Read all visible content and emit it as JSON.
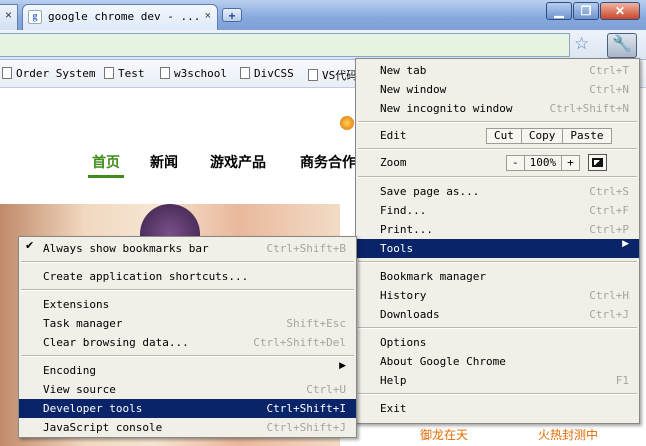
{
  "tab": {
    "title": "google chrome dev - ...",
    "favicon_letter": "g",
    "close_glyph": "×",
    "left_close": "×"
  },
  "newtab_glyph": "+",
  "window": {
    "minimize": "▁",
    "maximize": "❐",
    "close": "✕"
  },
  "toolbar": {
    "star": "☆",
    "wrench": "🔧"
  },
  "bookmarks": [
    "Order System",
    "Test",
    "w3school",
    "DivCSS",
    "VS代码"
  ],
  "page": {
    "nav": [
      "首页",
      "新闻",
      "游戏产品",
      "商务合作"
    ],
    "bottom_left": "御龙在天",
    "bottom_right": "火热封测中"
  },
  "main_menu": {
    "new_tab": {
      "label": "New tab",
      "shortcut": "Ctrl+T"
    },
    "new_window": {
      "label": "New window",
      "shortcut": "Ctrl+N"
    },
    "new_incognito": {
      "label": "New incognito window",
      "shortcut": "Ctrl+Shift+N"
    },
    "edit": {
      "label": "Edit",
      "cut": "Cut",
      "copy": "Copy",
      "paste": "Paste"
    },
    "zoom": {
      "label": "Zoom",
      "minus": "-",
      "level": "100%",
      "plus": "+"
    },
    "save_page": {
      "label": "Save page as...",
      "shortcut": "Ctrl+S"
    },
    "find": {
      "label": "Find...",
      "shortcut": "Ctrl+F"
    },
    "print": {
      "label": "Print...",
      "shortcut": "Ctrl+P"
    },
    "tools": {
      "label": "Tools",
      "arrow": "▶"
    },
    "bookmark_manager": {
      "label": "Bookmark manager"
    },
    "history": {
      "label": "History",
      "shortcut": "Ctrl+H"
    },
    "downloads": {
      "label": "Downloads",
      "shortcut": "Ctrl+J"
    },
    "options": {
      "label": "Options"
    },
    "about": {
      "label": "About Google Chrome"
    },
    "help": {
      "label": "Help",
      "shortcut": "F1"
    },
    "exit": {
      "label": "Exit"
    }
  },
  "tools_menu": {
    "show_bookmarks_bar": {
      "label": "Always show bookmarks bar",
      "shortcut": "Ctrl+Shift+B",
      "check": "✔"
    },
    "create_shortcuts": {
      "label": "Create application shortcuts..."
    },
    "extensions": {
      "label": "Extensions"
    },
    "task_manager": {
      "label": "Task manager",
      "shortcut": "Shift+Esc"
    },
    "clear_data": {
      "label": "Clear browsing data...",
      "shortcut": "Ctrl+Shift+Del"
    },
    "encoding": {
      "label": "Encoding",
      "arrow": "▶"
    },
    "view_source": {
      "label": "View source",
      "shortcut": "Ctrl+U"
    },
    "developer_tools": {
      "label": "Developer tools",
      "shortcut": "Ctrl+Shift+I"
    },
    "javascript_console": {
      "label": "JavaScript console",
      "shortcut": "Ctrl+Shift+J"
    }
  }
}
